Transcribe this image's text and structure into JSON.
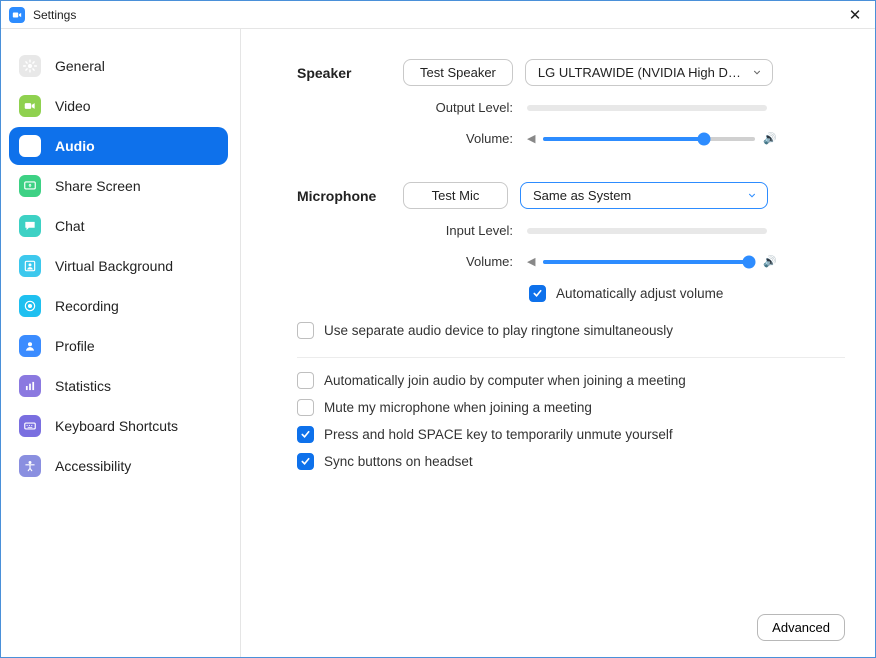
{
  "window": {
    "title": "Settings"
  },
  "sidebar": {
    "items": [
      {
        "label": "General"
      },
      {
        "label": "Video"
      },
      {
        "label": "Audio"
      },
      {
        "label": "Share Screen"
      },
      {
        "label": "Chat"
      },
      {
        "label": "Virtual Background"
      },
      {
        "label": "Recording"
      },
      {
        "label": "Profile"
      },
      {
        "label": "Statistics"
      },
      {
        "label": "Keyboard Shortcuts"
      },
      {
        "label": "Accessibility"
      }
    ]
  },
  "audio": {
    "speaker": {
      "title": "Speaker",
      "test_label": "Test Speaker",
      "device": "LG ULTRAWIDE (NVIDIA High Defi…",
      "output_level_label": "Output Level:",
      "volume_label": "Volume:",
      "volume_percent": 76
    },
    "microphone": {
      "title": "Microphone",
      "test_label": "Test Mic",
      "device": "Same as System",
      "input_level_label": "Input Level:",
      "volume_label": "Volume:",
      "volume_percent": 97,
      "auto_adjust_label": "Automatically adjust volume",
      "auto_adjust_checked": true
    },
    "ringtone": {
      "label": "Use separate audio device to play ringtone simultaneously",
      "checked": false
    },
    "options": [
      {
        "label": "Automatically join audio by computer when joining a meeting",
        "checked": false
      },
      {
        "label": "Mute my microphone when joining a meeting",
        "checked": false
      },
      {
        "label": "Press and hold SPACE key to temporarily unmute yourself",
        "checked": true
      },
      {
        "label": "Sync buttons on headset",
        "checked": true
      }
    ],
    "advanced_label": "Advanced"
  }
}
